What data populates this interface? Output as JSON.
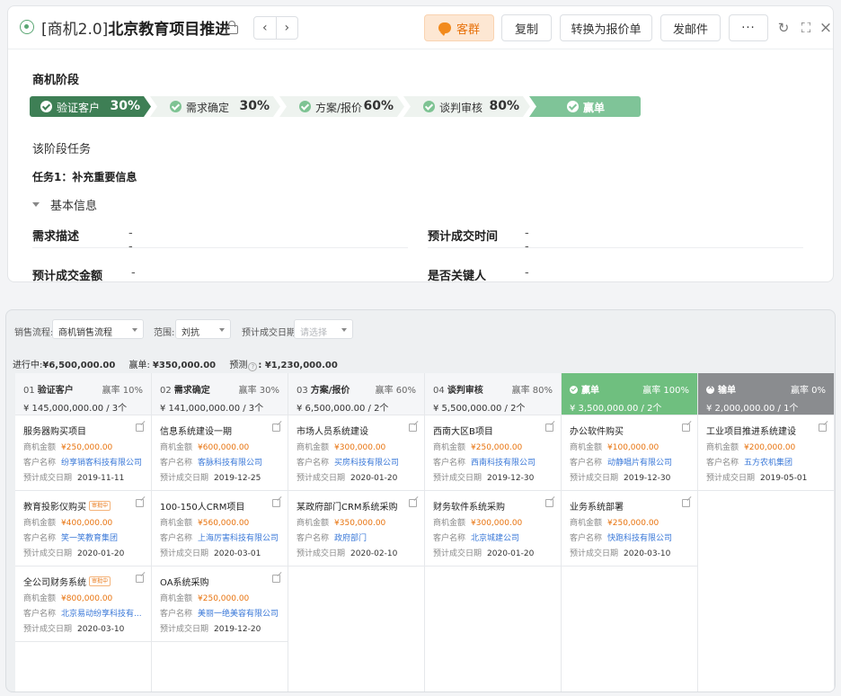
{
  "detail": {
    "tag": "[商机2.0]",
    "title": "北京教育项目推进",
    "nav_prev": "‹",
    "nav_next": "›",
    "btn_kequn": "客群",
    "btn_copy": "复制",
    "btn_convert": "转换为报价单",
    "btn_email": "发邮件",
    "btn_more": "···",
    "stage_label": "商机阶段",
    "stages": [
      {
        "name": "验证客户",
        "pct": "30%"
      },
      {
        "name": "需求确定",
        "pct": "30%"
      },
      {
        "name": "方案/报价",
        "pct": "60%"
      },
      {
        "name": "谈判审核",
        "pct": "80%"
      },
      {
        "name": "赢单",
        "pct": ""
      }
    ],
    "tasks_label": "该阶段任务",
    "task1": "任务1：补充重要信息",
    "section": "基本信息",
    "fields": [
      {
        "label": "需求描述",
        "value": "--"
      },
      {
        "label": "预计成交时间",
        "value": "--"
      },
      {
        "label": "预计成交金额",
        "value": "--"
      },
      {
        "label": "是否关键人",
        "value": "--"
      }
    ]
  },
  "board": {
    "filters": {
      "flow_label": "销售流程:",
      "flow_value": "商机销售流程",
      "scope_label": "范围:",
      "scope_value": "刘抗",
      "date_label": "预计成交日期:",
      "date_placeholder": "请选择"
    },
    "summary": {
      "ongoing_label": "进行中:",
      "ongoing_value": "¥6,500,000.00",
      "won_label": "赢单:",
      "won_value": "¥350,000.00",
      "forecast_label": "预测",
      "forecast_value": ":  ¥1,230,000.00"
    },
    "field_labels": {
      "amount": "商机金额",
      "customer": "客户名称",
      "date": "预计成交日期"
    },
    "columns": [
      {
        "no": "01",
        "name": "验证客户",
        "rate": "赢率 10%",
        "total": "¥ 145,000,000.00 / 3个",
        "cards": [
          {
            "title": "服务器购买项目",
            "badge": "",
            "amount": "¥250,000.00",
            "customer": "纷享销客科技有限公司",
            "date": "2019-11-11"
          },
          {
            "title": "教育投影仪购买",
            "badge": "审批中",
            "amount": "¥400,000.00",
            "customer": "笑一笑教育集团",
            "date": "2020-01-20"
          },
          {
            "title": "全公司财务系统",
            "badge": "审批中",
            "amount": "¥800,000.00",
            "customer": "北京易动纷享科技有...",
            "date": "2020-03-10"
          }
        ]
      },
      {
        "no": "02",
        "name": "需求确定",
        "rate": "赢率 30%",
        "total": "¥ 141,000,000.00 / 3个",
        "cards": [
          {
            "title": "信息系统建设一期",
            "badge": "",
            "amount": "¥600,000.00",
            "customer": "客脉科技有限公司",
            "date": "2019-12-25"
          },
          {
            "title": "100-150人CRM项目",
            "badge": "",
            "amount": "¥560,000.00",
            "customer": "上海厉害科技有限公司",
            "date": "2020-03-01"
          },
          {
            "title": "OA系统采购",
            "badge": "",
            "amount": "¥250,000.00",
            "customer": "美丽一绝美容有限公司",
            "date": "2019-12-20"
          }
        ]
      },
      {
        "no": "03",
        "name": "方案/报价",
        "rate": "赢率 60%",
        "total": "¥ 6,500,000.00 / 2个",
        "cards": [
          {
            "title": "市场人员系统建设",
            "badge": "",
            "amount": "¥300,000.00",
            "customer": "买房科技有限公司",
            "date": "2020-01-20"
          },
          {
            "title": "某政府部门CRM系统采购",
            "badge": "",
            "amount": "¥350,000.00",
            "customer": "政府部门",
            "date": "2020-02-10"
          }
        ]
      },
      {
        "no": "04",
        "name": "谈判审核",
        "rate": "赢率 80%",
        "total": "¥ 5,500,000.00 / 2个",
        "cards": [
          {
            "title": "西南大区B项目",
            "badge": "",
            "amount": "¥250,000.00",
            "customer": "西南科技有限公司",
            "date": "2019-12-30"
          },
          {
            "title": "财务软件系统采购",
            "badge": "",
            "amount": "¥300,000.00",
            "customer": "北京城建公司",
            "date": "2020-01-20"
          }
        ]
      },
      {
        "no": "",
        "name": "赢单",
        "rate": "赢率 100%",
        "total": "¥ 3,500,000.00 / 2个",
        "cards": [
          {
            "title": "办公软件购买",
            "badge": "",
            "amount": "¥100,000.00",
            "customer": "动静唱片有限公司",
            "date": "2019-12-30"
          },
          {
            "title": "业务系统部署",
            "badge": "",
            "amount": "¥250,000.00",
            "customer": "快跑科技有限公司",
            "date": "2020-03-10"
          }
        ]
      },
      {
        "no": "",
        "name": "输单",
        "rate": "赢率 0%",
        "total": "¥ 2,000,000.00 / 1个",
        "cards": [
          {
            "title": "工业项目推进系统建设",
            "badge": "",
            "amount": "¥200,000.00",
            "customer": "五方农机集团",
            "date": "2019-05-01"
          }
        ]
      }
    ]
  }
}
